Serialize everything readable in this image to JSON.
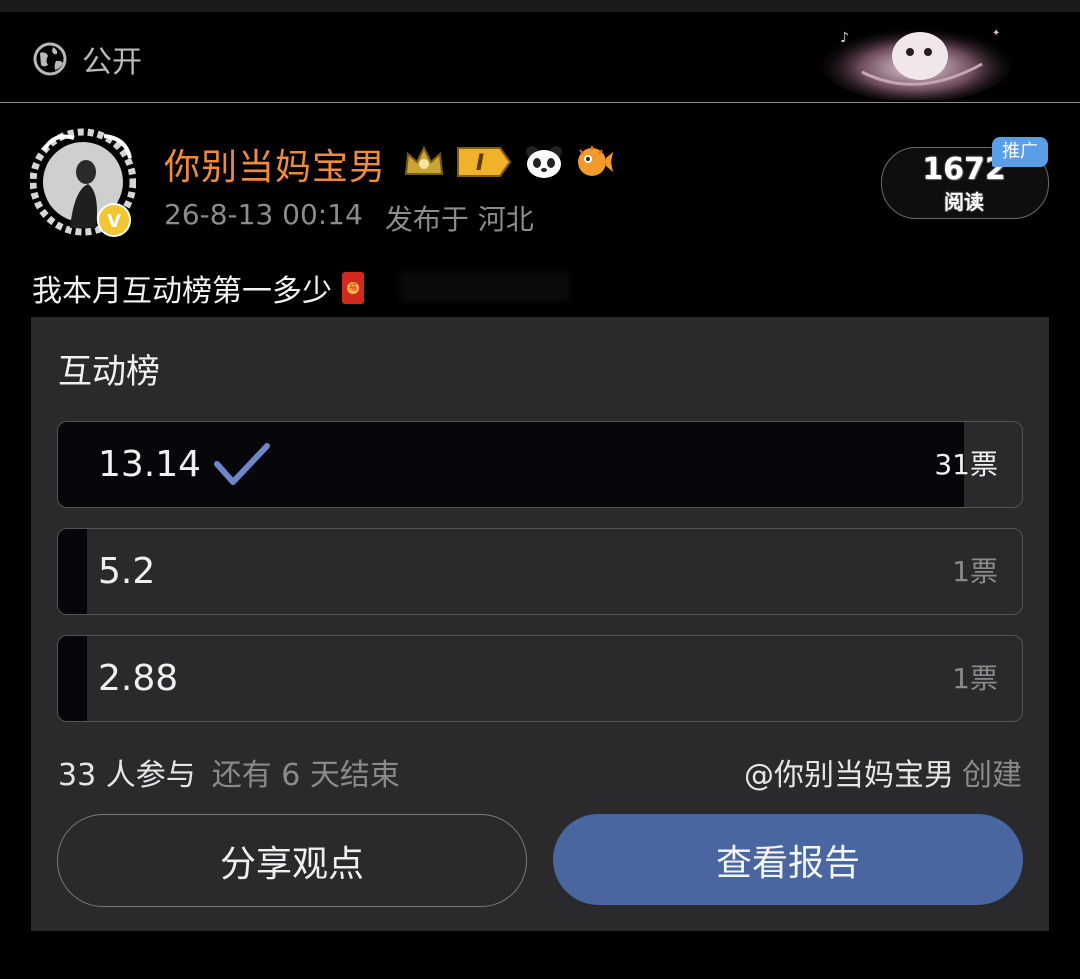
{
  "topbar": {
    "visibility_icon": "globe-icon",
    "visibility_label": "公开"
  },
  "post": {
    "author": "你别当妈宝男",
    "badges": [
      "crown-badge",
      "level-badge",
      "panda-badge",
      "pufferfish-badge"
    ],
    "level_badge_text": "I",
    "time": "26-8-13 00:14",
    "location": "发布于 河北",
    "verified_icon": "verified-v-icon",
    "verified_text": "V",
    "reads": {
      "count": "1672",
      "label": "阅读"
    },
    "promo_label": "推广",
    "text": "我本月互动榜第一多少",
    "text_icon": "red-packet-icon",
    "red_packet_text": "福"
  },
  "poll": {
    "title": "互动榜",
    "options": [
      {
        "label": "13.14",
        "votes": "31票",
        "selected": true,
        "share": 0.94
      },
      {
        "label": "5.2",
        "votes": "1票",
        "selected": false,
        "share": 0.03
      },
      {
        "label": "2.88",
        "votes": "1票",
        "selected": false,
        "share": 0.03
      }
    ],
    "participants": "33 人参与",
    "remaining": "还有 6 天结束",
    "creator_name": "@你别当妈宝男",
    "creator_suffix": "创建",
    "share_button": "分享观点",
    "report_button": "查看报告"
  },
  "colors": {
    "username": "#f08b3c",
    "accent_button": "#4a66a0",
    "check": "#6f86c8",
    "promo": "#5b9ee8"
  }
}
